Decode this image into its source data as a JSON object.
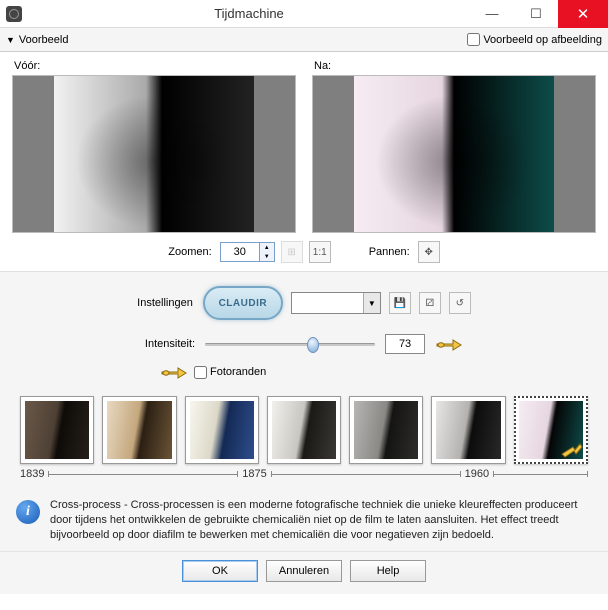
{
  "title": "Tijdmachine",
  "toolbar": {
    "preview": "Voorbeeld",
    "on_image": "Voorbeeld op afbeelding"
  },
  "preview": {
    "before": "Vóór:",
    "after": "Na:"
  },
  "zoom": {
    "label": "Zoomen:",
    "value": "30",
    "pan": "Pannen:",
    "oneToOne": "1:1"
  },
  "settings": {
    "label": "Instellingen",
    "badge": "CLAUDIR"
  },
  "intensity": {
    "label": "Intensiteit:",
    "value": "73",
    "percent": 60
  },
  "photoborders": {
    "label": "Fotoranden"
  },
  "timeline": {
    "y1": "1839",
    "y2": "1875",
    "y3": "1960"
  },
  "info_text": "Cross-process - Cross-processen is een moderne fotografische techniek die unieke kleureffecten produceert door tijdens het ontwikkelen de gebruikte chemicaliën niet op de film te laten aansluiten. Het effect treedt bijvoorbeeld op door diafilm te bewerken met chemicaliën die voor negatieven zijn bedoeld.",
  "buttons": {
    "ok": "OK",
    "cancel": "Annuleren",
    "help": "Help"
  },
  "icons": {
    "min": "—",
    "max": "☐",
    "close": "✕",
    "move": "✥",
    "save": "💾",
    "dice": "⚂",
    "swap": "↺"
  }
}
